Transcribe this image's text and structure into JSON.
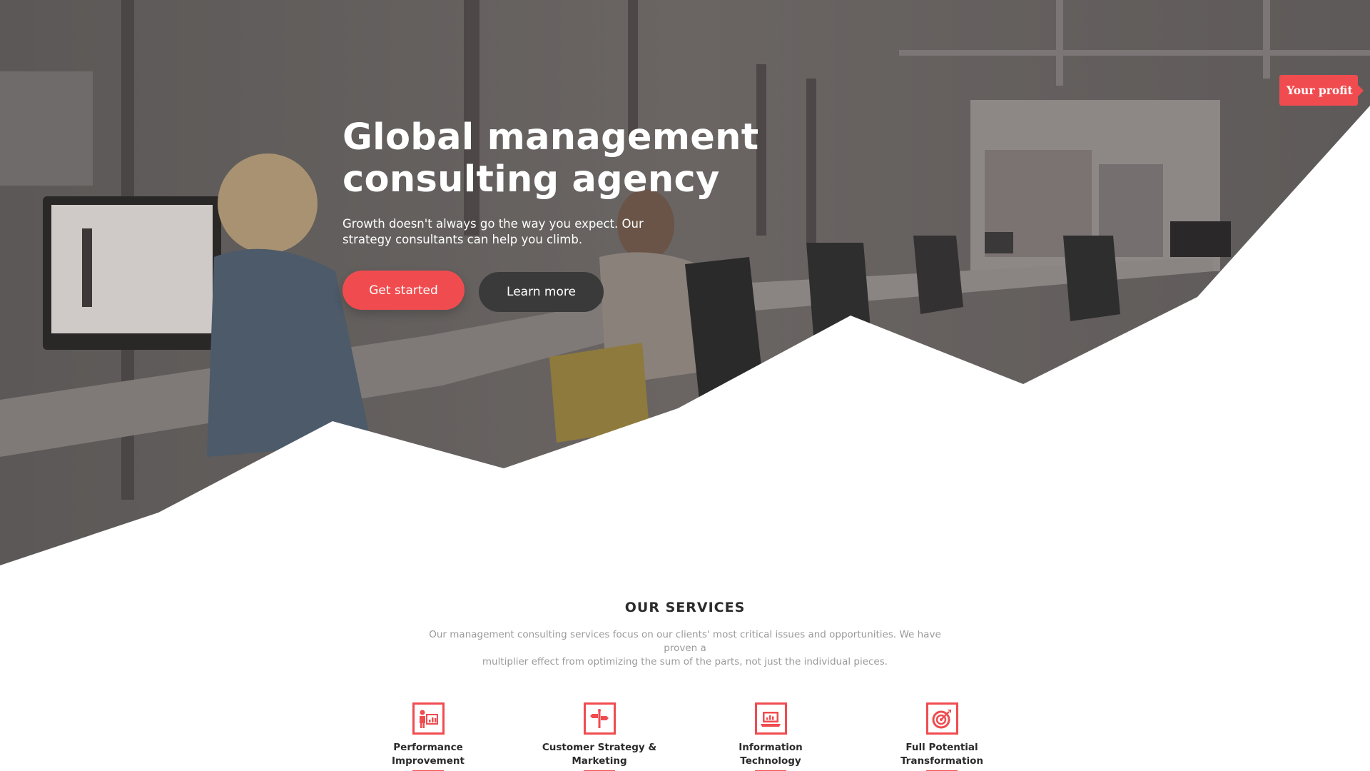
{
  "hero": {
    "title_line1": "Global management",
    "title_line2": "consulting agency",
    "subtitle_line1": "Growth doesn't always go the way you expect. Our",
    "subtitle_line2": "strategy consultants can help you climb.",
    "primary_button": "Get started",
    "secondary_button": "Learn more",
    "profit_tag": "Your profit",
    "background_image": "office-workspace-photo"
  },
  "services": {
    "heading": "OUR SERVICES",
    "description_line1": "Our management consulting services focus on our clients' most critical issues and opportunities. We have proven a",
    "description_line2": "multiplier effect from optimizing the sum of the parts, not just the individual pieces.",
    "items": [
      {
        "line1": "Performance",
        "line2": "Improvement",
        "icon": "presentation-chart-icon"
      },
      {
        "line1": "Customer Strategy &",
        "line2": "Marketing",
        "icon": "signpost-icon"
      },
      {
        "line1": "Information",
        "line2": "Technology",
        "icon": "laptop-chart-icon"
      },
      {
        "line1": "Full Potential",
        "line2": "Transformation",
        "icon": "target-icon"
      }
    ]
  },
  "colors": {
    "accent": "#f04c4f",
    "dark_button": "#3a3a3a",
    "heading_text": "#2b2b2b",
    "muted_text": "#9a9a9a"
  }
}
